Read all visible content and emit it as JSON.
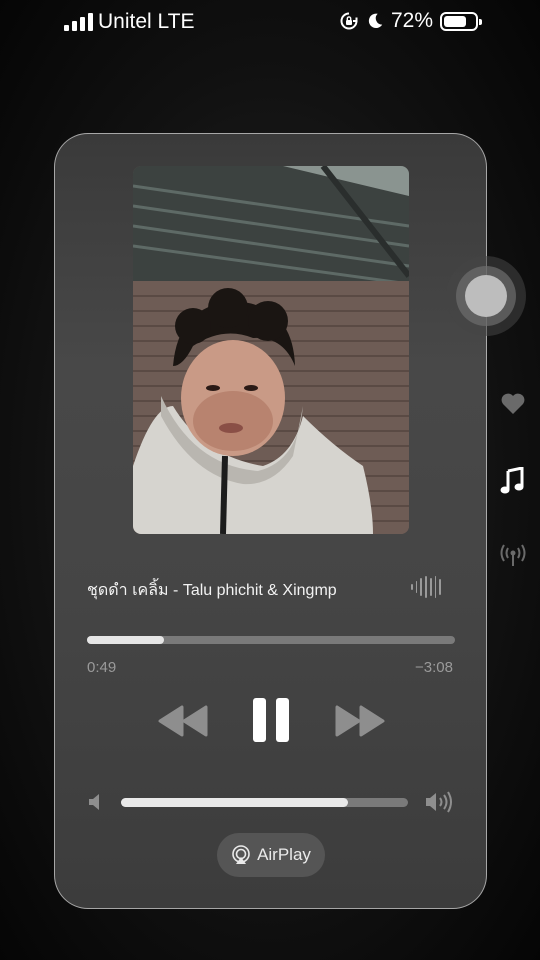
{
  "status_bar": {
    "carrier": "Unitel LTE",
    "battery_percent": "72%",
    "battery_level": 0.72,
    "icons": [
      "signal-bars-icon",
      "rotation-lock-icon",
      "moon-icon",
      "battery-icon"
    ]
  },
  "player": {
    "track_title": "ชุดดำ เคลิ้ม - Talu phichit & Xingmp",
    "time_elapsed": "0:49",
    "time_remaining": "−3:08",
    "progress_fraction": 0.21,
    "volume_fraction": 0.79,
    "airplay_label": "AirPlay",
    "icons": [
      "rewind-icon",
      "pause-icon",
      "fast-forward-icon",
      "volume-low-icon",
      "volume-high-icon",
      "airplay-icon",
      "waveform-icon"
    ]
  },
  "side_controls": {
    "icons": [
      "heart-icon",
      "music-note-icon",
      "broadcast-icon"
    ]
  },
  "colors": {
    "card_border": "#8c8c8c",
    "progress_fill": "#e6e6e6",
    "progress_track": "#7a7a7a",
    "secondary_text": "#9a9a9a"
  }
}
